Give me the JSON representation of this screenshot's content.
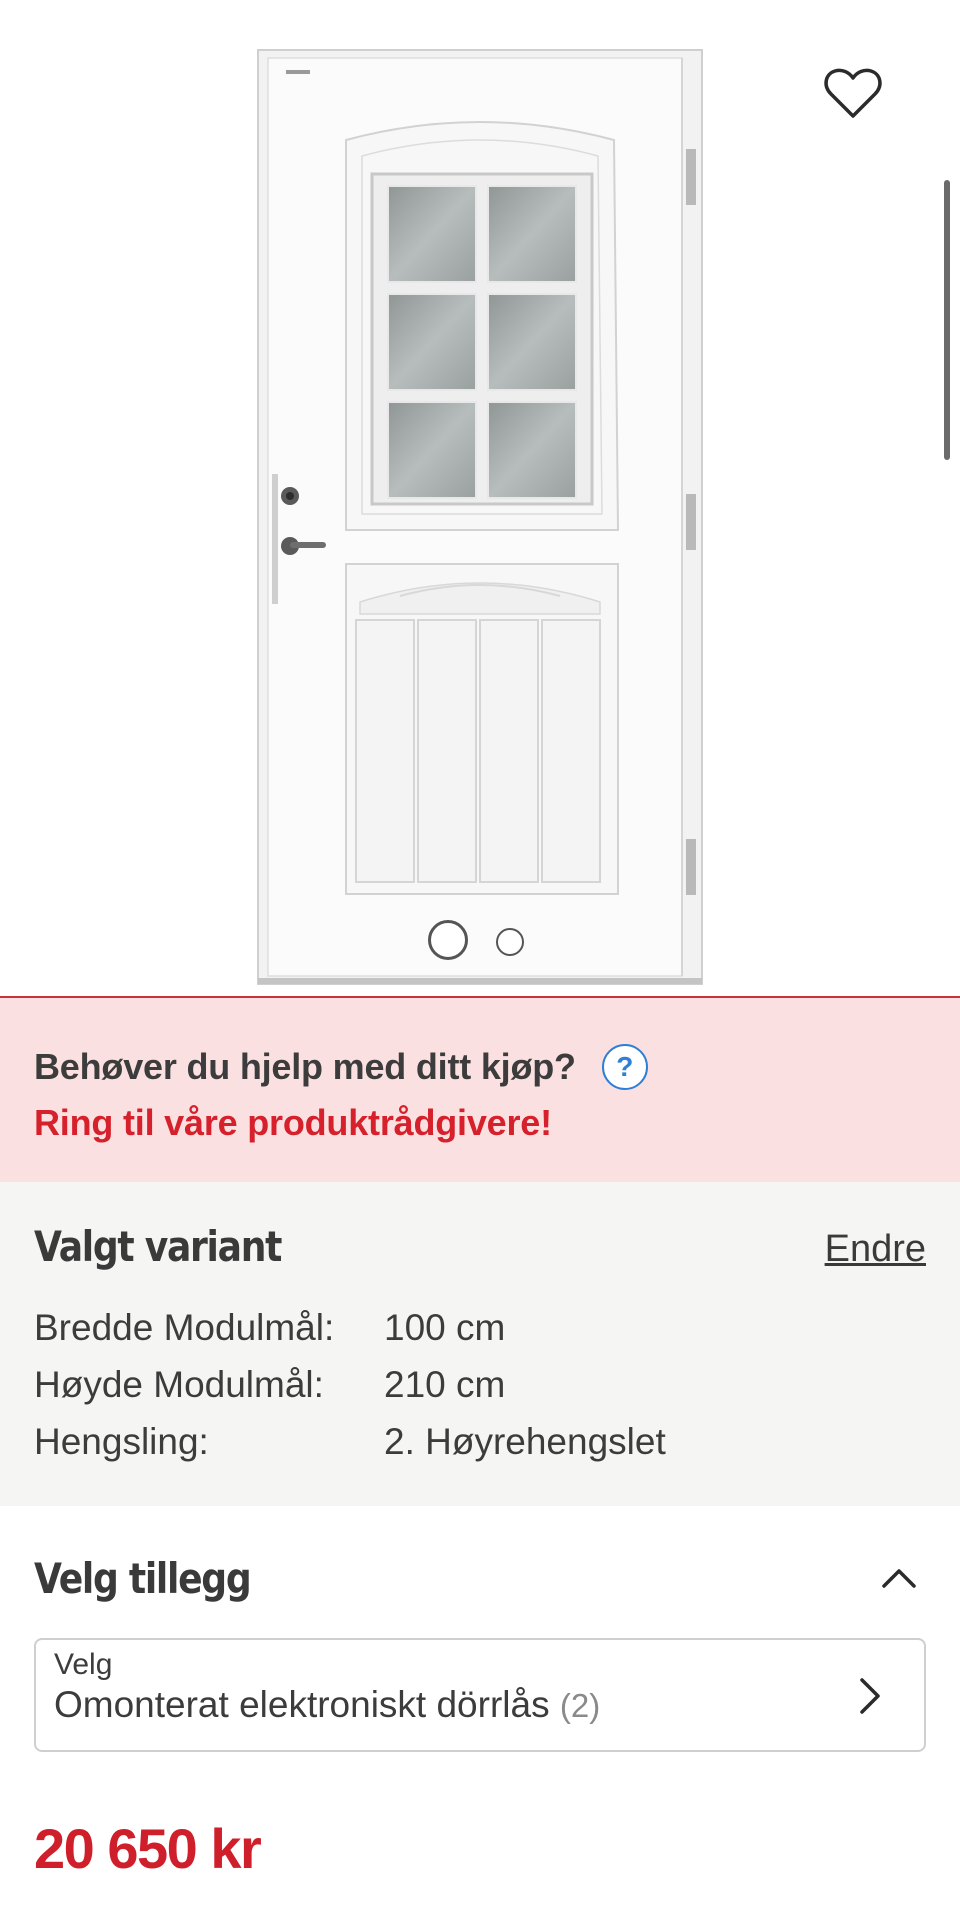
{
  "gallery": {
    "image_alt": "Door product image",
    "favorite_icon": "heart-outline-icon",
    "active_slide": 1,
    "slide_count": 2
  },
  "help": {
    "question": "Behøver du hjelp med ditt kjøp?",
    "help_icon_text": "?",
    "call_text": "Ring til våre produktrådgivere!"
  },
  "variant": {
    "title": "Valgt variant",
    "change_label": "Endre",
    "specs": [
      {
        "label": "Bredde Modulmål:",
        "value": "100 cm"
      },
      {
        "label": "Høyde Modulmål:",
        "value": "210 cm"
      },
      {
        "label": "Hengsling:",
        "value": "2. Høyrehengslet"
      }
    ]
  },
  "addons": {
    "title": "Velg tillegg",
    "select_label": "Velg",
    "select_value": "Omonterat elektroniskt dörrlås",
    "select_count": "(2)"
  },
  "price": "20 650 kr",
  "colors": {
    "accent_red": "#d6202b",
    "banner_bg": "#fbe0e1",
    "info_blue": "#2f7fd6",
    "variant_bg": "#f5f6f4"
  }
}
